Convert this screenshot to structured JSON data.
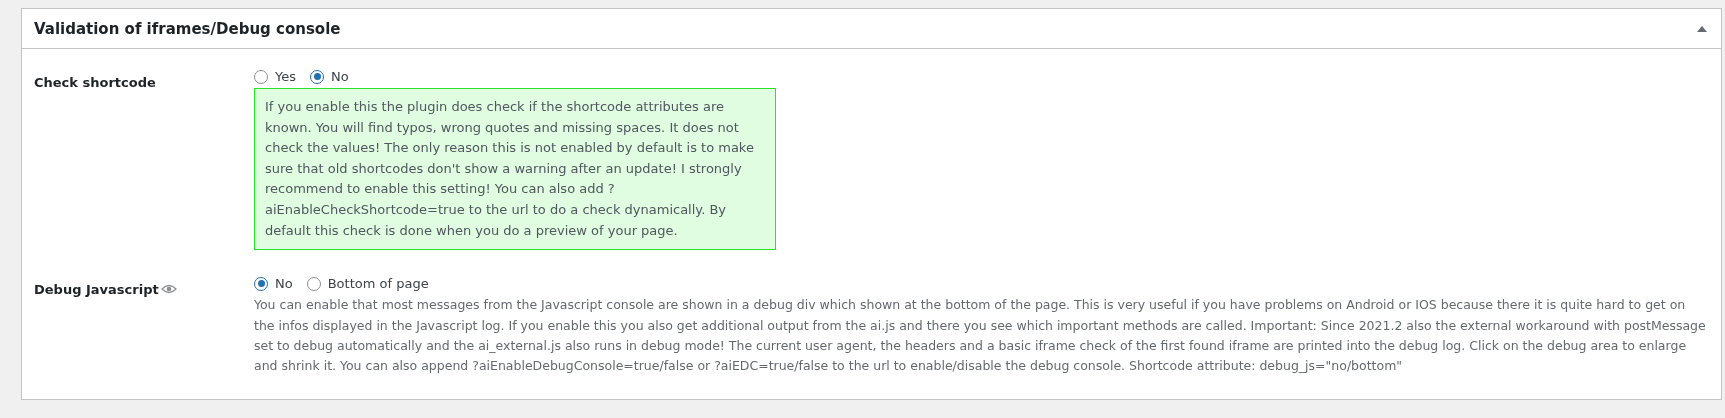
{
  "panel": {
    "title": "Validation of iframes/Debug console",
    "expanded": true
  },
  "settings": [
    {
      "label": "Check shortcode",
      "info_icon": false,
      "options": [
        {
          "label": "Yes",
          "selected": false
        },
        {
          "label": "No",
          "selected": true
        }
      ],
      "kind": "notice",
      "description": "If you enable this the plugin does check if the shortcode attributes are known. You will find typos, wrong quotes and missing spaces. It does not check the values! The only reason this is not enabled by default is to make sure that old shortcodes don't show a warning after an update! I strongly recommend to enable this setting! You can also add ?aiEnableCheckShortcode=true to the url to do a check dynamically. By default this check is done when you do a preview of your page."
    },
    {
      "label": "Debug Javascript",
      "info_icon": true,
      "options": [
        {
          "label": "No",
          "selected": true
        },
        {
          "label": "Bottom of page",
          "selected": false
        }
      ],
      "kind": "plain",
      "description": "You can enable that most messages from the Javascript console are shown in a debug div which shown at the bottom of the page. This is very useful if you have problems on Android or IOS because there it is quite hard to get on the infos displayed in the Javascript log. If you enable this you also get additional output from the ai.js and there you see which important methods are called. Important: Since 2021.2 also the external workaround with postMessage set to debug automatically and the ai_external.js also runs in debug mode! The current user agent, the headers and a basic iframe check of the first found iframe are printed into the debug log. Click on the debug area to enlarge and shrink it. You can also append ?aiEnableDebugConsole=true/false or ?aiEDC=true/false to the url to enable/disable the debug console. Shortcode attribute: debug_js=\"no/bottom\""
    }
  ]
}
